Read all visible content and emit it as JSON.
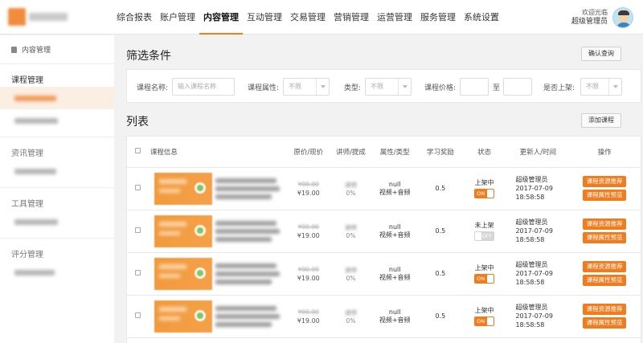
{
  "nav": {
    "items": [
      "综合报表",
      "账户管理",
      "内容管理",
      "互动管理",
      "交易管理",
      "营销管理",
      "运营管理",
      "服务管理",
      "系统设置"
    ],
    "active_index": 2
  },
  "user": {
    "greeting": "欢迎光临",
    "name": "超级管理员"
  },
  "sidebar": {
    "header": "内容管理",
    "groups": [
      {
        "title": "课程管理"
      },
      {
        "title": "资讯管理"
      },
      {
        "title": "工具管理"
      },
      {
        "title": "评分管理"
      }
    ]
  },
  "filter": {
    "title": "筛选条件",
    "confirm_label": "确认查询",
    "course_name_label": "课程名称:",
    "course_name_placeholder": "输入课程名称",
    "attr_label": "课程属性:",
    "attr_value": "不限",
    "type_label": "类型:",
    "type_value": "不限",
    "price_label": "课程价格:",
    "price_to": "至",
    "listed_label": "是否上架:",
    "listed_value": "不限"
  },
  "list": {
    "title": "列表",
    "add_label": "添加课程",
    "columns": [
      "课程信息",
      "原价/现价",
      "讲师/提成",
      "属性/类型",
      "学习奖励",
      "状态",
      "更新人/时间",
      "操作"
    ],
    "rows": [
      {
        "now_price": "¥19.00",
        "commission": "0%",
        "attr": "null",
        "type": "视频+音频",
        "reward": "0.5",
        "status": "上架中",
        "toggle": "ON",
        "on": true,
        "updater": "超级管理员",
        "date": "2017-07-09",
        "time": "18:58:58",
        "action1": "课程资源推荐",
        "action2": "课程属性预览"
      },
      {
        "now_price": "¥19.00",
        "commission": "0%",
        "attr": "null",
        "type": "视频+音频",
        "reward": "0.5",
        "status": "未上架",
        "toggle": "OFF",
        "on": false,
        "updater": "超级管理员",
        "date": "2017-07-09",
        "time": "18:58:58",
        "action1": "课程资源推荐",
        "action2": "课程属性预览"
      },
      {
        "now_price": "¥19.00",
        "commission": "0%",
        "attr": "null",
        "type": "视频+音频",
        "reward": "0.5",
        "status": "上架中",
        "toggle": "ON",
        "on": true,
        "updater": "超级管理员",
        "date": "2017-07-09",
        "time": "18:58:58",
        "action1": "课程资源推荐",
        "action2": "课程属性预览"
      },
      {
        "now_price": "¥19.00",
        "commission": "0%",
        "attr": "null",
        "type": "视频+音频",
        "reward": "0.5",
        "status": "上架中",
        "toggle": "ON",
        "on": true,
        "updater": "超级管理员",
        "date": "2017-07-09",
        "time": "18:58:58",
        "action1": "课程资源推荐",
        "action2": "课程属性预览"
      }
    ]
  }
}
